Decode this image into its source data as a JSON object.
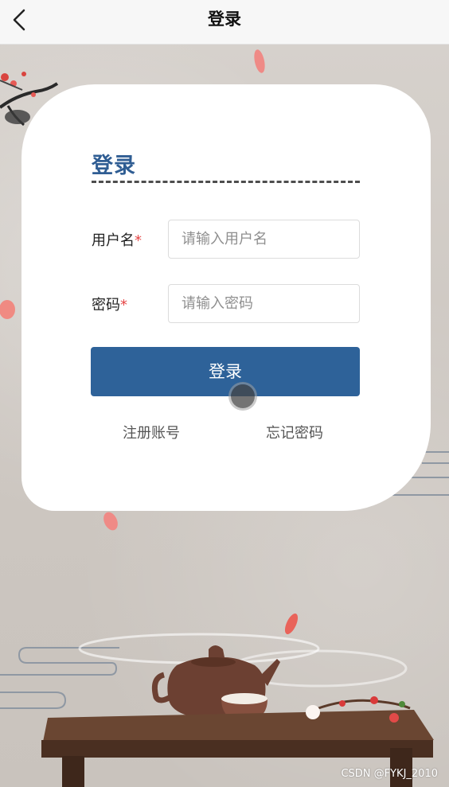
{
  "navbar": {
    "back_icon": "chevron-left-icon",
    "title": "登录"
  },
  "login_card": {
    "heading": "登录",
    "username": {
      "label": "用户名",
      "required_mark": "*",
      "placeholder": "请输入用户名",
      "value": ""
    },
    "password": {
      "label": "密码",
      "required_mark": "*",
      "placeholder": "请输入密码",
      "value": ""
    },
    "submit_label": "登录",
    "register_link": "注册账号",
    "forgot_link": "忘记密码"
  },
  "watermark": "CSDN @FYKJ_2010",
  "colors": {
    "accent": "#2e6299",
    "heading": "#2f5d93",
    "required": "#e64646",
    "navbar_bg": "#f7f7f7"
  }
}
